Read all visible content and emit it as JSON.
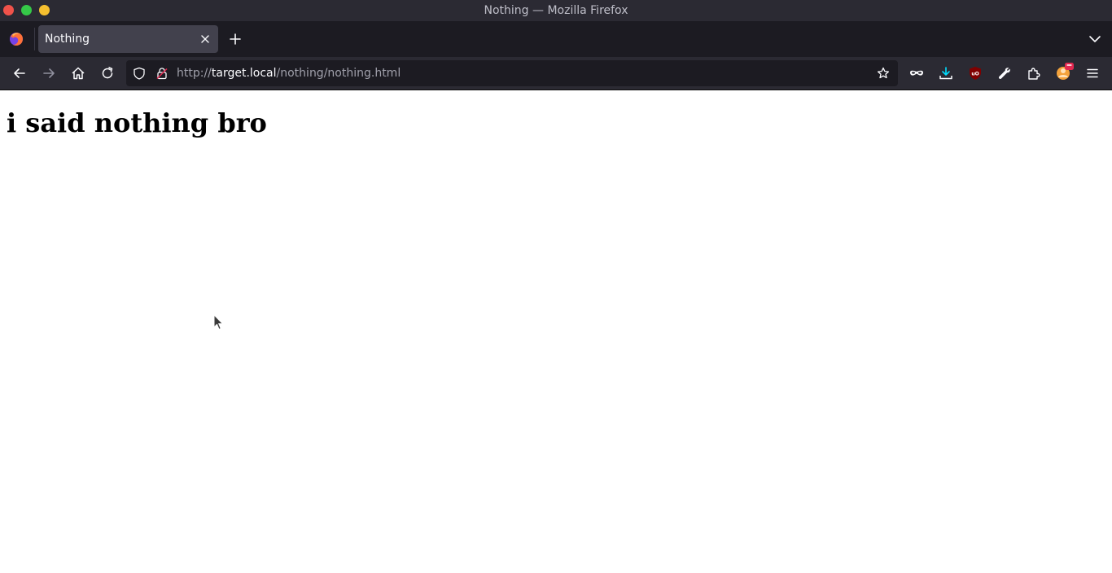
{
  "window": {
    "title": "Nothing — Mozilla Firefox"
  },
  "tabs": [
    {
      "label": "Nothing",
      "active": true
    }
  ],
  "navbar": {
    "url": {
      "scheme": "http://",
      "host": "target.local",
      "path": "/nothing/nothing.html"
    }
  },
  "icons": {
    "back": "arrow-left",
    "forward": "arrow-right",
    "home": "house",
    "reload": "circular-arrow",
    "tracking": "shield",
    "lock": "padlock-crossed",
    "bookmark": "star-outline",
    "private": "mask",
    "downloads": "download-arrow",
    "ublock": "shield-red",
    "devtools": "wrench",
    "extensions": "puzzle",
    "profile": "avatar",
    "menu": "hamburger"
  },
  "page": {
    "heading": "i said nothing bro"
  },
  "colors": {
    "titlebar": "#2b2a33",
    "tabstrip": "#1c1b22",
    "active_tab": "#42414d",
    "urlbar": "#1c1b22",
    "downloads_accent": "#00ddff",
    "ublock_red": "#800000"
  }
}
